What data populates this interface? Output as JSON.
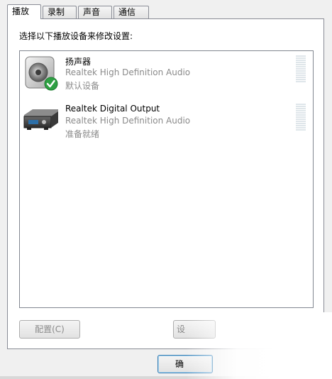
{
  "tabs": [
    {
      "label": "播放"
    },
    {
      "label": "录制"
    },
    {
      "label": "声音"
    },
    {
      "label": "通信"
    }
  ],
  "instruction": "选择以下播放设备来修改设置:",
  "devices": [
    {
      "name": "扬声器",
      "description": "Realtek High Definition Audio",
      "status": "默认设备",
      "icon": "speaker-icon"
    },
    {
      "name": "Realtek Digital Output",
      "description": "Realtek High Definition Audio",
      "status": "准备就绪",
      "icon": "digital-output-icon"
    }
  ],
  "buttons": {
    "configure": "配置(C)",
    "set_default": "设",
    "ok": "确"
  },
  "colors": {
    "default_check": "#2ea043",
    "meter": "#dfe6ea"
  }
}
